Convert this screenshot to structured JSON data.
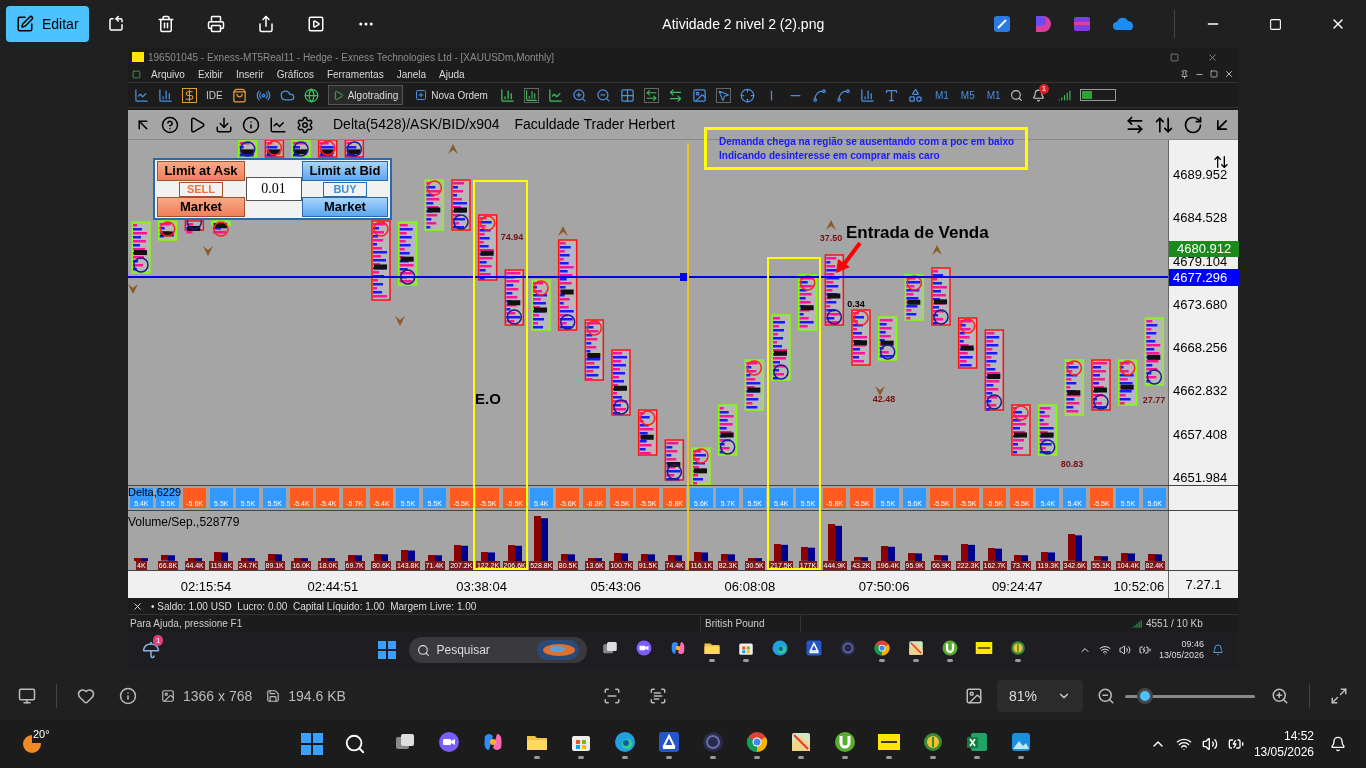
{
  "photos_app": {
    "edit_button": "Editar",
    "file_title": "Atividade 2 nivel 2 (2).png"
  },
  "mt5": {
    "window_title": "196501045 - Exness-MT5Real11 - Hedge - Exness Technologies Ltd - [XAUUSDm,Monthly]",
    "menu": [
      "Arquivo",
      "Exibir",
      "Inserir",
      "Gráficos",
      "Ferramentas",
      "Janela",
      "Ajuda"
    ],
    "toolbar": {
      "ide": "IDE",
      "algotrading": "Algotrading",
      "new_order": "Nova Ordem",
      "timeframes": [
        "M1",
        "M5",
        "M1"
      ],
      "alert_badge": "1"
    },
    "chart": {
      "indicator": "Delta(5428)/ASK/BID/x904",
      "brand": "Faculdade Trader Herbert",
      "trade_panel": {
        "sell_limit": "Limit at Ask",
        "sell": "SELL",
        "sell_market": "Market",
        "lot": "0.01",
        "buy_limit": "Limit at Bid",
        "buy": "BUY",
        "buy_market": "Market"
      },
      "note": [
        "Demanda chega na região se ausentando com a poc em baixo",
        "Indicando desinteresse em comprar mais caro"
      ],
      "eo_label": "E.O",
      "entry_label": "Entrada de Venda",
      "value_labels": [
        {
          "text": "74.94",
          "color": "#7a1010"
        },
        {
          "text": "37.50",
          "color": "#7a1010"
        },
        {
          "text": "0.34",
          "color": "#000000"
        },
        {
          "text": "42.48",
          "color": "#7a1010"
        },
        {
          "text": "80.83",
          "color": "#7a1010"
        },
        {
          "text": "27.77",
          "color": "#7a1010"
        }
      ],
      "price_ticks": [
        "4689.952",
        "4684.528",
        "4679.104",
        "4673.680",
        "4668.256",
        "4662.832",
        "4657.408",
        "4651.984"
      ],
      "ask_price": "4680.912",
      "bid_price": "4677.296",
      "delta_label": "Delta,6229",
      "volume_label": "Volume/Sep.,528779",
      "delta": [
        {
          "value": "5.4K",
          "color": "#3399ff"
        },
        {
          "value": "5.5K",
          "color": "#3399ff"
        },
        {
          "value": "-5.6K",
          "color": "#ff5a1f"
        },
        {
          "value": "5.5K",
          "color": "#3399ff"
        },
        {
          "value": "5.5K",
          "color": "#3399ff"
        },
        {
          "value": "5.5K",
          "color": "#3399ff"
        },
        {
          "value": "-5.4K",
          "color": "#ff5a1f"
        },
        {
          "value": "-5.4K",
          "color": "#ff5a1f"
        },
        {
          "value": "-5.7K",
          "color": "#ff5a1f"
        },
        {
          "value": "-5.4K",
          "color": "#ff5a1f"
        },
        {
          "value": "5.5K",
          "color": "#3399ff"
        },
        {
          "value": "5.5K",
          "color": "#3399ff"
        },
        {
          "value": "-5.5K",
          "color": "#ff5a1f"
        },
        {
          "value": "-5.5K",
          "color": "#ff5a1f"
        },
        {
          "value": "-5.5K",
          "color": "#ff5a1f"
        },
        {
          "value": "5.4K",
          "color": "#3399ff"
        },
        {
          "value": "-5.6K",
          "color": "#ff5a1f"
        },
        {
          "value": "-6.2K",
          "color": "#ff5a1f"
        },
        {
          "value": "-5.5K",
          "color": "#ff5a1f"
        },
        {
          "value": "-5.5K",
          "color": "#ff5a1f"
        },
        {
          "value": "-5.8K",
          "color": "#ff5a1f"
        },
        {
          "value": "5.6K",
          "color": "#3399ff"
        },
        {
          "value": "5.7K",
          "color": "#3399ff"
        },
        {
          "value": "5.5K",
          "color": "#3399ff"
        },
        {
          "value": "5.4K",
          "color": "#3399ff"
        },
        {
          "value": "5.5K",
          "color": "#3399ff"
        },
        {
          "value": "-5.8K",
          "color": "#ff5a1f"
        },
        {
          "value": "-5.5K",
          "color": "#ff5a1f"
        },
        {
          "value": "5.5K",
          "color": "#3399ff"
        },
        {
          "value": "5.6K",
          "color": "#3399ff"
        },
        {
          "value": "-5.5K",
          "color": "#ff5a1f"
        },
        {
          "value": "-5.5K",
          "color": "#ff5a1f"
        },
        {
          "value": "-5.5K",
          "color": "#ff5a1f"
        },
        {
          "value": "-5.5K",
          "color": "#ff5a1f"
        },
        {
          "value": "5.4K",
          "color": "#3399ff"
        },
        {
          "value": "5.4K",
          "color": "#3399ff"
        },
        {
          "value": "-5.5K",
          "color": "#ff5a1f"
        },
        {
          "value": "5.5K",
          "color": "#3399ff"
        },
        {
          "value": "5.6K",
          "color": "#3399ff"
        }
      ],
      "volume": [
        "4K",
        "66.8K",
        "44.4K",
        "119.8K",
        "24.7K",
        "89.1K",
        "16.0K",
        "18.0K",
        "69.7K",
        "80.6K",
        "143.8K",
        "71.4K",
        "207.2K",
        "122.2K",
        "206.6K",
        "528.8K",
        "80.5K",
        "13.6K",
        "100.7K",
        "91.5K",
        "74.4K",
        "116.1K",
        "82.3K",
        "30.5K",
        "217.5K",
        "177K",
        "444.9K",
        "43.2K",
        "196.4K",
        "95.9K",
        "66.9K",
        "222.3K",
        "162.7K",
        "73.7K",
        "119.3K",
        "342.6K",
        "55.1K",
        "104.4K",
        "82.4K"
      ],
      "time_ticks": [
        "02:15:54",
        "02:44:51",
        "03:38:04",
        "05:43:06",
        "06:08:08",
        "07:50:06",
        "09:24:47",
        "10:52:06"
      ],
      "axis_corner": "7.27.1"
    },
    "account_bar": "• Saldo: 1.00 USD  Lucro: 0.00  Capital Líquido: 1.00  Margem Livre: 1.00",
    "status_bar": {
      "help": "Para Ajuda, pressione F1",
      "currency": "British Pound",
      "traffic": "4551 / 10 Kb"
    },
    "taskbar": {
      "weather_badge": "1",
      "search": "Pesquisar",
      "apps": [
        {
          "kind": "taskview",
          "running": false
        },
        {
          "kind": "meet",
          "running": false
        },
        {
          "kind": "copilot",
          "running": false
        },
        {
          "kind": "folder",
          "running": true
        },
        {
          "kind": "store",
          "running": true
        },
        {
          "kind": "edge",
          "running": false
        },
        {
          "kind": "scanner",
          "running": false
        },
        {
          "kind": "obs",
          "running": false
        },
        {
          "kind": "chrome",
          "running": true
        },
        {
          "kind": "photos",
          "running": true
        },
        {
          "kind": "torrent",
          "running": true
        },
        {
          "kind": "exness",
          "running": false
        },
        {
          "kind": "metatrader",
          "running": true
        }
      ],
      "time": "09:46",
      "date": "13/05/2026"
    }
  },
  "photo_bar": {
    "dimensions": "1366 x 768",
    "file_size": "194.6 KB",
    "zoom": "81%",
    "zoom_slider": {
      "level": 0.15
    }
  },
  "taskbar": {
    "weather": "20°",
    "apps": [
      {
        "kind": "taskview",
        "running": false
      },
      {
        "kind": "meet",
        "running": false
      },
      {
        "kind": "copilot",
        "running": false
      },
      {
        "kind": "folder",
        "running": true
      },
      {
        "kind": "store",
        "running": true
      },
      {
        "kind": "edge",
        "running": true
      },
      {
        "kind": "scanner",
        "running": true
      },
      {
        "kind": "obs",
        "running": true
      },
      {
        "kind": "chrome",
        "running": true
      },
      {
        "kind": "photos",
        "running": true
      },
      {
        "kind": "torrent",
        "running": true
      },
      {
        "kind": "exness",
        "running": true
      },
      {
        "kind": "metatrader",
        "running": true
      },
      {
        "kind": "excel",
        "running": true
      },
      {
        "kind": "gallery",
        "running": true
      }
    ],
    "time": "14:52",
    "date": "13/05/2026"
  }
}
